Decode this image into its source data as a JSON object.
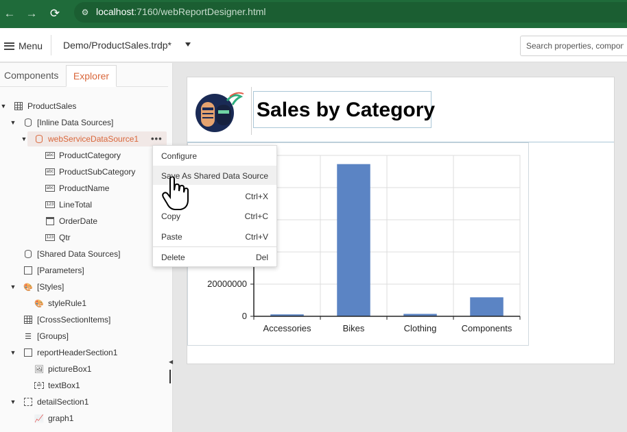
{
  "browser": {
    "url_host": "localhost",
    "url_path": ":7160/webReportDesigner.html"
  },
  "toolbar": {
    "menu_label": "Menu",
    "document_title": "Demo/ProductSales.trdp*",
    "search_placeholder": "Search properties, components"
  },
  "tabs": {
    "components": "Components",
    "explorer": "Explorer"
  },
  "tree": {
    "product_sales": "ProductSales",
    "inline_data_sources": "[Inline Data Sources]",
    "web_service_data_source": "webServiceDataSource1",
    "fields": [
      {
        "label": "ProductCategory",
        "type_icon": "abc"
      },
      {
        "label": "ProductSubCategory",
        "type_icon": "abc"
      },
      {
        "label": "ProductName",
        "type_icon": "abc"
      },
      {
        "label": "LineTotal",
        "type_icon": "123"
      },
      {
        "label": "OrderDate",
        "type_icon": "date"
      },
      {
        "label": "Qtr",
        "type_icon": "123"
      }
    ],
    "shared_data_sources": "[Shared Data Sources]",
    "parameters": "[Parameters]",
    "styles": "[Styles]",
    "style_rule": "styleRule1",
    "cross_section_items": "[CrossSectionItems]",
    "groups": "[Groups]",
    "report_header_section": "reportHeaderSection1",
    "picture_box": "pictureBox1",
    "text_box": "textBox1",
    "detail_section": "detailSection1",
    "graph": "graph1"
  },
  "context_menu": {
    "configure": "Configure",
    "save_shared": "Save As Shared Data Source",
    "cut_shortcut": "Ctrl+X",
    "copy": "Copy",
    "copy_shortcut": "Ctrl+C",
    "paste": "Paste",
    "paste_shortcut": "Ctrl+V",
    "delete": "Delete",
    "delete_shortcut": "Del"
  },
  "report": {
    "title": "Sales by Category"
  },
  "colors": {
    "accent": "#d9663a",
    "bar": "#5b84c4",
    "browser_green": "#1f6b3a"
  },
  "chart_data": {
    "type": "bar",
    "categories": [
      "Accessories",
      "Bikes",
      "Clothing",
      "Components"
    ],
    "values": [
      1200000,
      94600000,
      1500000,
      11800000
    ],
    "y_tick_labels": [
      "0",
      "20000000"
    ],
    "ylim": [
      0,
      100000000
    ],
    "grid": true,
    "title": "",
    "xlabel": "",
    "ylabel": ""
  }
}
